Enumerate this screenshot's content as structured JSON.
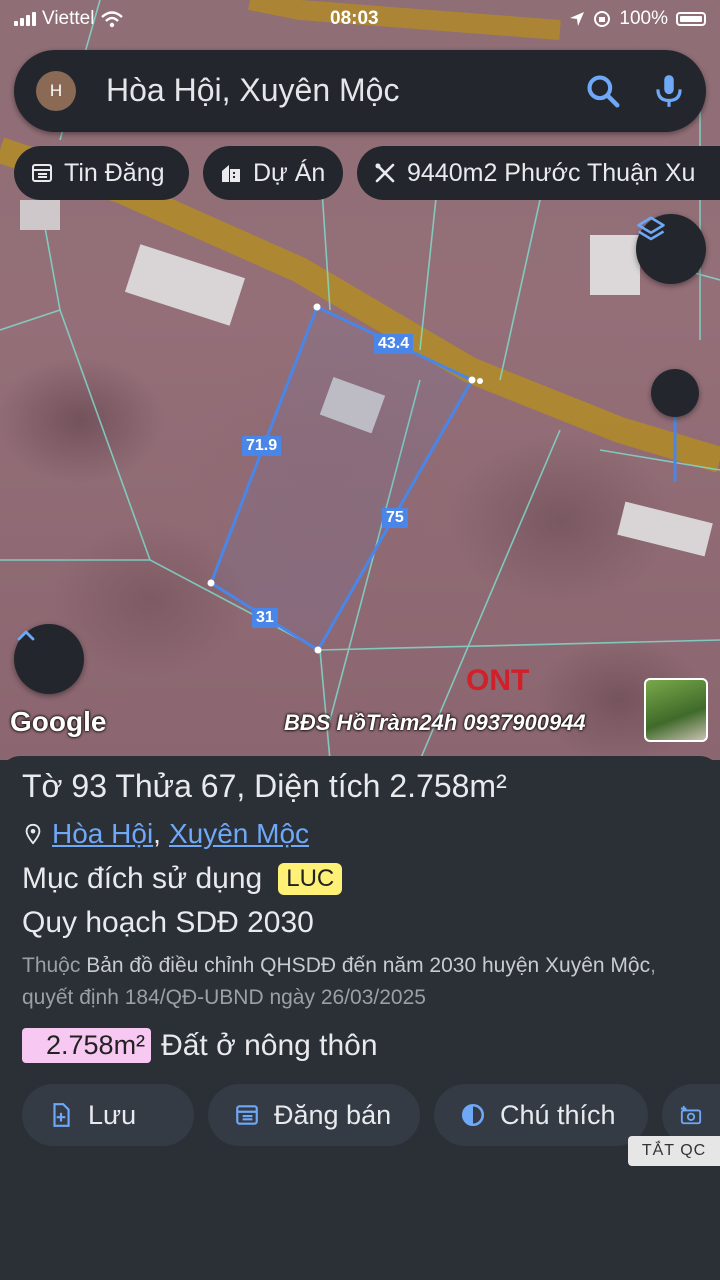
{
  "status_bar": {
    "carrier": "Viettel",
    "time": "08:03",
    "battery": "100%"
  },
  "search": {
    "avatar_letter": "H",
    "query": "Hòa Hội, Xuyên Mộc"
  },
  "chips": [
    {
      "label": "Tin Đăng",
      "icon": "listing-icon"
    },
    {
      "label": "Dự Án",
      "icon": "building-icon"
    },
    {
      "label": "9440m2 Phước Thuận Xu",
      "icon": "tools-icon"
    }
  ],
  "map": {
    "edge_labels": [
      "43.4",
      "71.9",
      "75",
      "31"
    ],
    "google_logo": "Google",
    "watermark": "BĐS HồTràm24h 0937900944",
    "zone_code": "ONT",
    "colors": {
      "parcel_outline": "#4a86e8",
      "road": "#b08a2a",
      "plot_lines": "#7fe0d0"
    }
  },
  "details": {
    "title": "Tờ 93 Thửa 67, Diện tích 2.758m²",
    "location": {
      "commune": "Hòa Hội",
      "district": "Xuyên Mộc",
      "separator": ","
    },
    "purpose_label": "Mục đích sử dụng",
    "purpose_code": "LUC",
    "plan_title": "Quy hoạch SDĐ 2030",
    "desc_prefix": "Thuộc",
    "desc_map": "Bản đồ điều chỉnh QHSDĐ đến năm 2030 huyện Xuyên Mộc",
    "desc_suffix": ", quyết định 184/QĐ-UBND ngày 26/03/2025",
    "area_value": "2.758m²",
    "area_type": "Đất ở nông thôn"
  },
  "actions": [
    {
      "label": "Lưu",
      "icon": "save-file-icon"
    },
    {
      "label": "Đăng bán",
      "icon": "post-sale-icon"
    },
    {
      "label": "Chú thích",
      "icon": "legend-contrast-icon"
    }
  ],
  "ad": {
    "close_label": "TẮT QC"
  }
}
